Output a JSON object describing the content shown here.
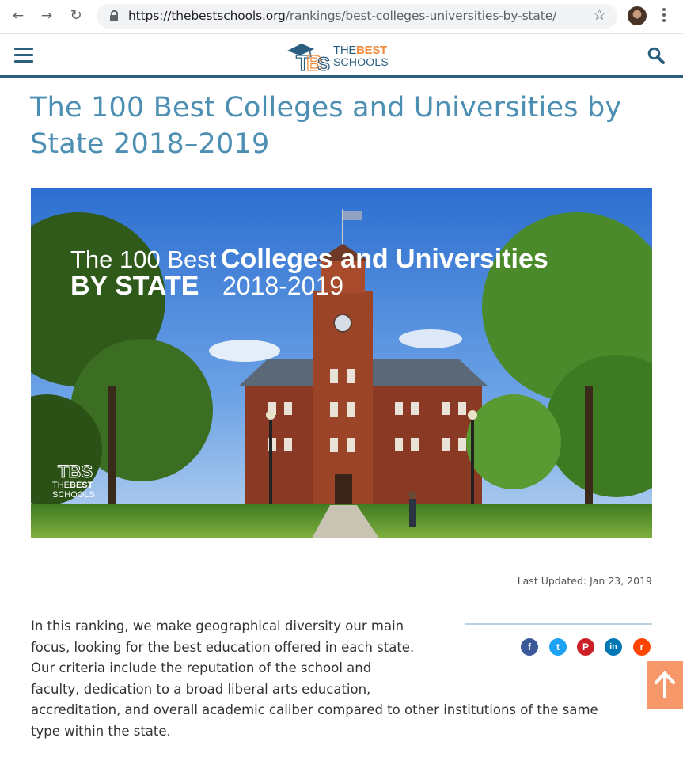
{
  "browser": {
    "url_host": "https://thebestschools.org",
    "url_path": "/rankings/best-colleges-universities-by-state/",
    "icons": {
      "back": "arrow-left-icon",
      "forward": "arrow-right-icon",
      "reload": "reload-icon",
      "lock": "lock-icon",
      "bookmark": "star-icon",
      "profile": "avatar",
      "menu": "kebab-menu-icon"
    }
  },
  "header": {
    "logo_the": "THE",
    "logo_best": "BEST",
    "logo_schools": "SCHOOLS",
    "menu_icon": "hamburger-icon",
    "search_icon": "search-icon",
    "brand_color": "#2a5f7f",
    "accent_color": "#f08a3c"
  },
  "article": {
    "title": "The 100 Best Colleges and Universities by State 2018–2019",
    "hero": {
      "line1_light": "The 100 Best",
      "line1_bold": "Colleges and Universities",
      "line2_bold": "BY STATE",
      "line2_light": "2018-2019",
      "watermark_the": "THE",
      "watermark_best": "BEST",
      "watermark_schools": "SCHOOLS"
    },
    "last_updated": "Last Updated: Jan 23, 2019",
    "share": [
      {
        "name": "facebook",
        "icon": "facebook-icon",
        "glyph": "f",
        "color": "#3b5998"
      },
      {
        "name": "twitter",
        "icon": "twitter-icon",
        "glyph": "t",
        "color": "#1da1f2"
      },
      {
        "name": "pinterest",
        "icon": "pinterest-icon",
        "glyph": "P",
        "color": "#cb2027"
      },
      {
        "name": "linkedin",
        "icon": "linkedin-icon",
        "glyph": "in",
        "color": "#0077b5"
      },
      {
        "name": "reddit",
        "icon": "reddit-icon",
        "glyph": "r",
        "color": "#ff4500"
      }
    ],
    "body_lines": [
      "In this ranking, we make geographical diversity our main",
      "focus, looking for the best education offered in each state.",
      "Our criteria include the reputation of the school and",
      "faculty, dedication to a broad liberal arts education,",
      "accreditation, and overall academic caliber compared to other institutions of the same",
      "type within the state."
    ]
  },
  "back_to_top": {
    "icon": "arrow-up-icon",
    "color": "#f7986a"
  }
}
